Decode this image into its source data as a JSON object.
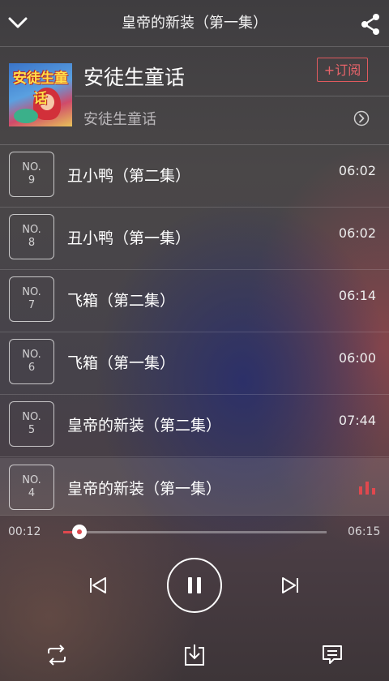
{
  "header": {
    "title": "皇帝的新装（第一集）",
    "back_icon": "chevron-down-icon",
    "share_icon": "share-icon"
  },
  "album": {
    "cover_text": "安徒生童话",
    "title": "安徒生童话",
    "subtitle": "安徒生童话",
    "subscribe_label": "+订阅"
  },
  "tracks": [
    {
      "no": "NO.",
      "num": "9",
      "name": "丑小鸭（第二集）",
      "duration": "06:02"
    },
    {
      "no": "NO.",
      "num": "8",
      "name": "丑小鸭（第一集）",
      "duration": "06:02"
    },
    {
      "no": "NO.",
      "num": "7",
      "name": "飞箱（第二集）",
      "duration": "06:14"
    },
    {
      "no": "NO.",
      "num": "6",
      "name": "飞箱（第一集）",
      "duration": "06:00"
    },
    {
      "no": "NO.",
      "num": "5",
      "name": "皇帝的新装（第二集）",
      "duration": "07:44"
    },
    {
      "no": "NO.",
      "num": "4",
      "name": "皇帝的新装（第一集）",
      "duration": "",
      "playing": true
    }
  ],
  "player": {
    "elapsed": "00:12",
    "total": "06:15",
    "progress_fraction": 0.06,
    "accent_color": "#e0484e"
  },
  "toolbar": {
    "icons": [
      "repeat-icon",
      "download-icon",
      "comment-icon"
    ]
  }
}
